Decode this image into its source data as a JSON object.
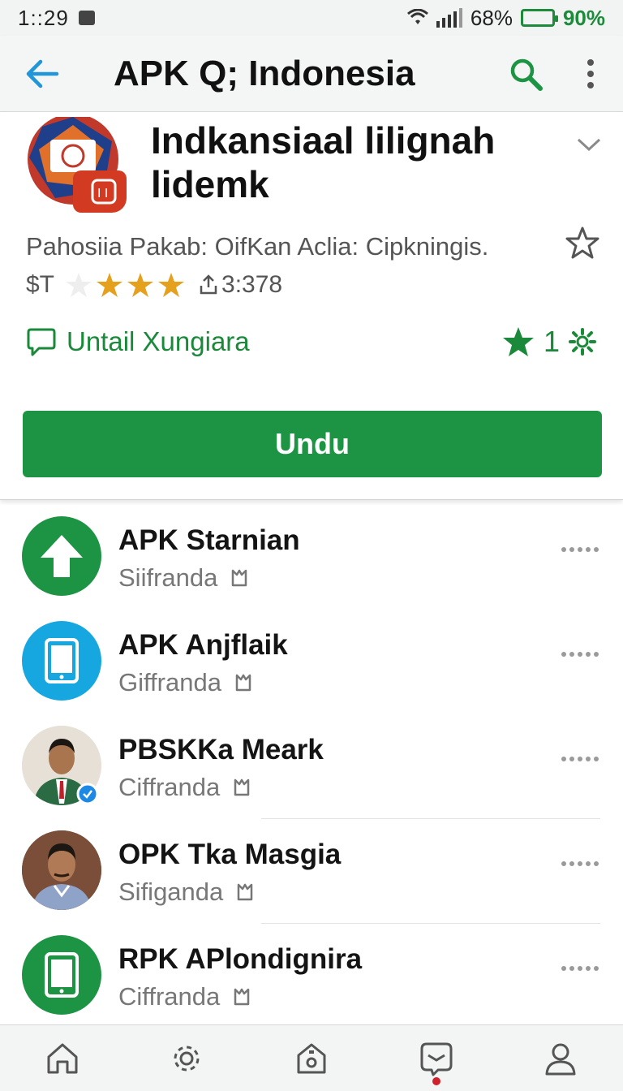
{
  "status_bar": {
    "time": "1::29",
    "signal_pct": "68%",
    "battery_pct": "90%",
    "battery_level": 0.9,
    "battery_color": "#1e8a3c"
  },
  "app_bar": {
    "title": "APK Q; Indonesia",
    "back_icon": "arrow-left-icon",
    "search_icon": "search-icon",
    "menu_icon": "more-vert-icon",
    "accent": "#2196d8",
    "brand_green": "#1d9444"
  },
  "app_card": {
    "name": "Indkansiaal lilignah lidemk",
    "developer_line": "Pahosiia Pakab: OifKan Aclia: Cipkningis.",
    "price_prefix": "$T",
    "rating_stars": 3,
    "download_count": "3:378",
    "feature_label": "Untail Xungiara",
    "feature_count": "1",
    "install_label": "Undu"
  },
  "list": {
    "items": [
      {
        "name": "APK Starnian",
        "sub": "Siifranda",
        "avatar": "upload-arrow-icon",
        "color": "#1d9444"
      },
      {
        "name": "APK Anjflaik",
        "sub": "Giffranda",
        "avatar": "tablet-icon",
        "color": "#17a7e0"
      },
      {
        "name": "PBSKKa Meark",
        "sub": "Ciffranda",
        "avatar": "person-photo",
        "color": "#2a6b44"
      },
      {
        "name": "OPK Tka Masgia",
        "sub": "Sifiganda",
        "avatar": "person-photo",
        "color": "#6b4a3a"
      },
      {
        "name": "RPK APlondignira",
        "sub": "Ciffranda",
        "avatar": "tablet-icon",
        "color": "#1d9444"
      }
    ]
  },
  "bottom_nav": {
    "items": [
      "home-icon",
      "settings-icon",
      "store-icon",
      "inbox-icon",
      "profile-icon"
    ],
    "active_index": 3
  }
}
